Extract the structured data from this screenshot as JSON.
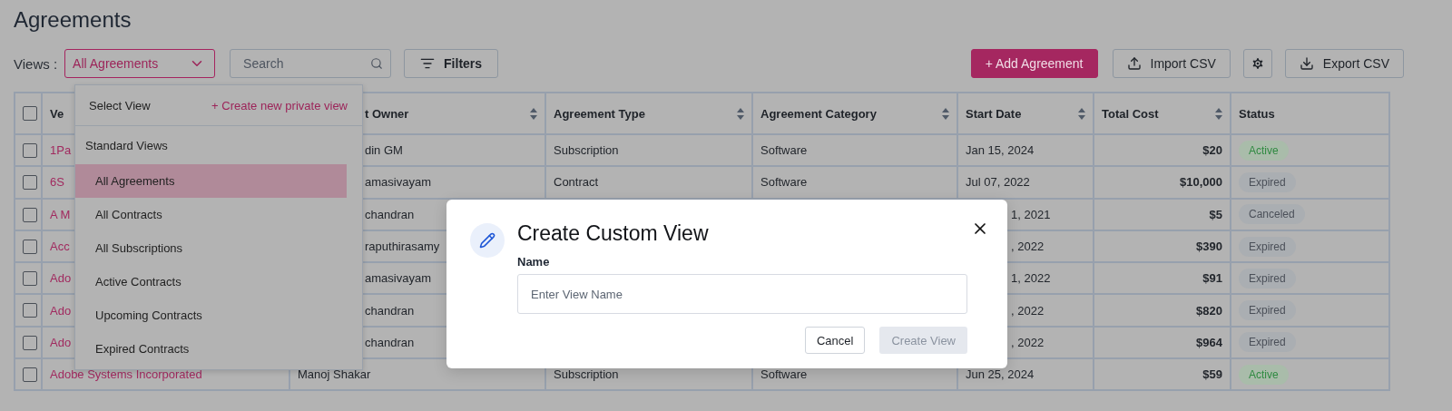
{
  "page": {
    "title": "Agreements"
  },
  "toolbar": {
    "views_label": "Views :",
    "view_select": {
      "value": "All Agreements",
      "open": true
    },
    "search": {
      "placeholder": "Search"
    },
    "filters_button": "Filters",
    "add_button": "+ Add Agreement",
    "import_button": "Import CSV",
    "export_button": "Export CSV"
  },
  "view_menu": {
    "title": "Select View",
    "create_link": "+ Create new private view",
    "group": "Standard Views",
    "items": [
      {
        "label": "All Agreements",
        "selected": true
      },
      {
        "label": "All Contracts",
        "selected": false
      },
      {
        "label": "All Subscriptions",
        "selected": false
      },
      {
        "label": "Active Contracts",
        "selected": false
      },
      {
        "label": "Upcoming Contracts",
        "selected": false
      },
      {
        "label": "Expired Contracts",
        "selected": false
      }
    ]
  },
  "table": {
    "select_all": {
      "checked": false
    },
    "columns": [
      {
        "label": "Ve",
        "sortable": false
      },
      {
        "label": "t Owner",
        "sortable": true
      },
      {
        "label": "Agreement Type",
        "sortable": true
      },
      {
        "label": "Agreement Category",
        "sortable": true
      },
      {
        "label": "Start Date",
        "sortable": true
      },
      {
        "label": "Total Cost",
        "sortable": true
      },
      {
        "label": "Status",
        "sortable": false
      }
    ],
    "rows": [
      {
        "checked": false,
        "cells": [
          "1Pa",
          "din GM",
          "Subscription",
          "Software",
          "Jan 15, 2024",
          "$20"
        ],
        "status": {
          "label": "Active",
          "kind": "active"
        }
      },
      {
        "checked": false,
        "cells": [
          "6S",
          "amasivayam",
          "Contract",
          "Software",
          "Jul 07, 2022",
          "$10,000"
        ],
        "status": {
          "label": "Expired",
          "kind": "expired"
        }
      },
      {
        "checked": false,
        "cells": [
          "A M",
          "chandran",
          null,
          null,
          "1, 2021",
          "$5"
        ],
        "status": {
          "label": "Canceled",
          "kind": "canceled"
        }
      },
      {
        "checked": false,
        "cells": [
          "Acc",
          "raputhirasamy",
          null,
          null,
          ", 2022",
          "$390"
        ],
        "status": {
          "label": "Expired",
          "kind": "expired"
        }
      },
      {
        "checked": false,
        "cells": [
          "Ado",
          "amasivayam",
          null,
          null,
          "1, 2022",
          "$91"
        ],
        "status": {
          "label": "Expired",
          "kind": "expired"
        }
      },
      {
        "checked": false,
        "cells": [
          "Ado",
          "chandran",
          null,
          null,
          ", 2022",
          "$820"
        ],
        "status": {
          "label": "Expired",
          "kind": "expired"
        }
      },
      {
        "checked": false,
        "cells": [
          "Ado",
          "chandran",
          null,
          null,
          ", 2022",
          "$964"
        ],
        "status": {
          "label": "Expired",
          "kind": "expired"
        }
      },
      {
        "checked": false,
        "cells": [
          "Adobe Systems Incorporated",
          "Manoj Shakar",
          "Subscription",
          "Software",
          "Jun 25, 2024",
          "$59"
        ],
        "status": {
          "label": "Active",
          "kind": "active"
        }
      }
    ]
  },
  "modal": {
    "title": "Create Custom View",
    "field_label": "Name",
    "field": {
      "placeholder": "Enter View Name"
    },
    "cancel_button": "Cancel",
    "create_button": {
      "label": "Create View",
      "disabled": true
    }
  }
}
